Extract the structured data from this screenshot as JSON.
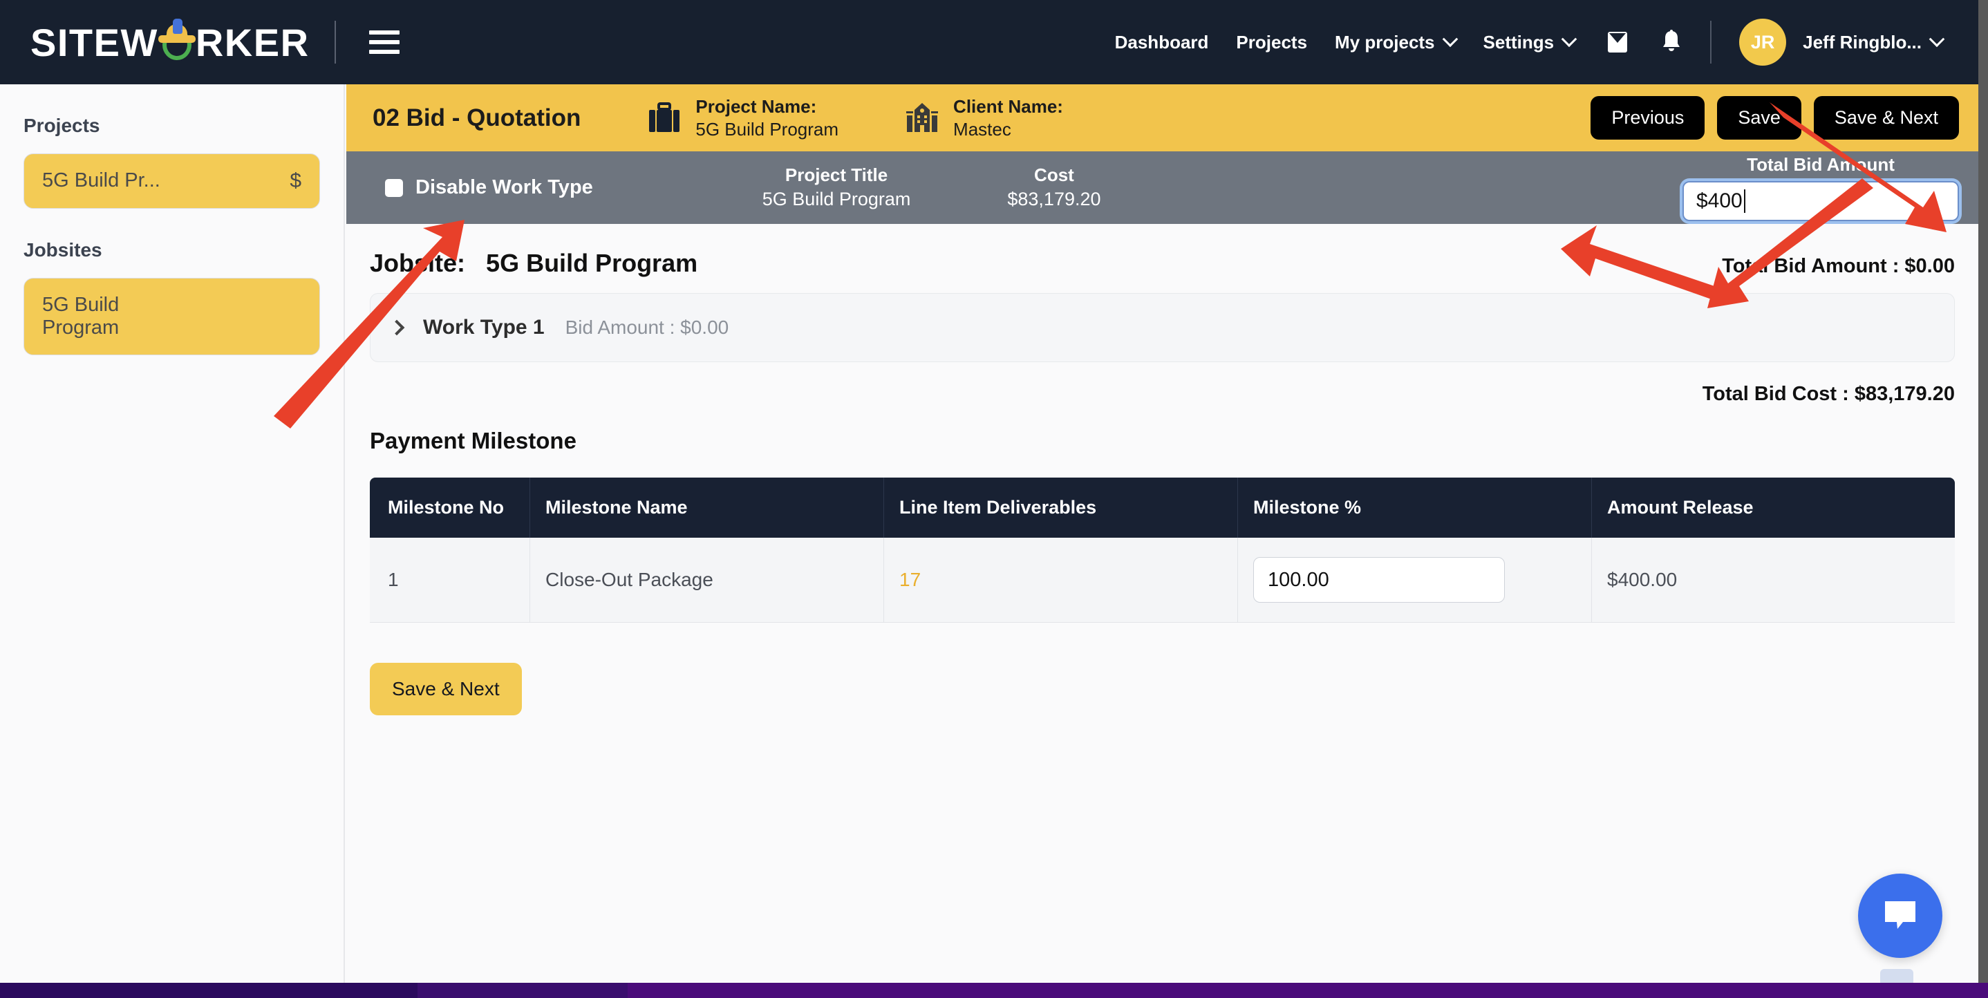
{
  "brand": {
    "text_before": "SITEW",
    "text_after": "RKER",
    "logo_icon": "hardhat-o-icon"
  },
  "nav": {
    "hamburger_icon": "hamburger-menu-icon",
    "links": [
      {
        "label": "Dashboard",
        "has_caret": false
      },
      {
        "label": "Projects",
        "has_caret": false
      },
      {
        "label": "My projects",
        "has_caret": true
      },
      {
        "label": "Settings",
        "has_caret": true
      }
    ],
    "mail_icon": "mail-icon",
    "bell_icon": "bell-notification-icon",
    "avatar_initials": "JR",
    "username": "Jeff Ringblo...",
    "user_caret_icon": "chevron-down-icon"
  },
  "sidebar": {
    "projects_heading": "Projects",
    "project_item": {
      "label": "5G Build Pr...",
      "badge": "$"
    },
    "jobsites_heading": "Jobsites",
    "jobsite_item": {
      "label": "5G Build Program"
    }
  },
  "header_bar": {
    "step_title": "02 Bid - Quotation",
    "project": {
      "icon": "briefcase-icon",
      "label": "Project Name:",
      "value": "5G Build Program"
    },
    "client": {
      "icon": "building-icon",
      "label": "Client Name:",
      "value": "Mastec"
    },
    "buttons": {
      "previous": "Previous",
      "save": "Save",
      "save_next": "Save & Next"
    }
  },
  "sub_bar": {
    "disable_work_type_label": "Disable Work Type",
    "disable_work_type_checked": false,
    "project_title_label": "Project Title",
    "project_title_value": "5G Build Program",
    "cost_label": "Cost",
    "cost_value": "$83,179.20",
    "total_bid_amount_label": "Total Bid Amount",
    "total_bid_amount_value": "$400"
  },
  "main": {
    "jobsite_label": "Jobsite:",
    "jobsite_name": "5G Build Program",
    "total_bid_amount_line": "Total Bid Amount : $0.00",
    "work_type": {
      "expand_icon": "chevron-right-icon",
      "name": "Work Type 1",
      "bid_amount": "Bid Amount : $0.00"
    },
    "total_bid_cost_line": "Total Bid Cost : $83,179.20",
    "payment_milestone_title": "Payment Milestone",
    "table": {
      "columns": [
        "Milestone No",
        "Milestone Name",
        "Line Item Deliverables",
        "Milestone %",
        "Amount Release"
      ],
      "rows": [
        {
          "milestone_no": "1",
          "milestone_name": "Close-Out Package",
          "line_item_deliverables": "17",
          "milestone_pct": "100.00",
          "amount_release": "$400.00"
        }
      ]
    },
    "save_next_button": "Save & Next"
  },
  "chat": {
    "icon": "chat-bubble-icon"
  },
  "colors": {
    "navy": "#17202f",
    "yellow": "#f2c44c",
    "gray_bar": "#6e757f",
    "table_header": "#182133",
    "gold_link": "#eaaf2e",
    "chat_blue": "#3b6fec",
    "annotation_red": "#e8402a"
  }
}
